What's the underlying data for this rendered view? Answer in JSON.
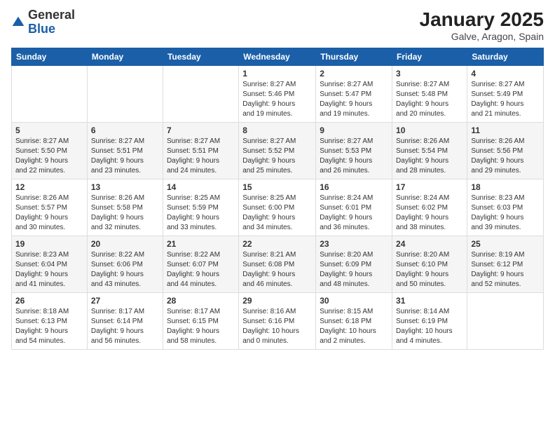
{
  "logo": {
    "general": "General",
    "blue": "Blue"
  },
  "title": "January 2025",
  "subtitle": "Galve, Aragon, Spain",
  "days_of_week": [
    "Sunday",
    "Monday",
    "Tuesday",
    "Wednesday",
    "Thursday",
    "Friday",
    "Saturday"
  ],
  "weeks": [
    [
      {
        "num": "",
        "info": ""
      },
      {
        "num": "",
        "info": ""
      },
      {
        "num": "",
        "info": ""
      },
      {
        "num": "1",
        "info": "Sunrise: 8:27 AM\nSunset: 5:46 PM\nDaylight: 9 hours\nand 19 minutes."
      },
      {
        "num": "2",
        "info": "Sunrise: 8:27 AM\nSunset: 5:47 PM\nDaylight: 9 hours\nand 19 minutes."
      },
      {
        "num": "3",
        "info": "Sunrise: 8:27 AM\nSunset: 5:48 PM\nDaylight: 9 hours\nand 20 minutes."
      },
      {
        "num": "4",
        "info": "Sunrise: 8:27 AM\nSunset: 5:49 PM\nDaylight: 9 hours\nand 21 minutes."
      }
    ],
    [
      {
        "num": "5",
        "info": "Sunrise: 8:27 AM\nSunset: 5:50 PM\nDaylight: 9 hours\nand 22 minutes."
      },
      {
        "num": "6",
        "info": "Sunrise: 8:27 AM\nSunset: 5:51 PM\nDaylight: 9 hours\nand 23 minutes."
      },
      {
        "num": "7",
        "info": "Sunrise: 8:27 AM\nSunset: 5:51 PM\nDaylight: 9 hours\nand 24 minutes."
      },
      {
        "num": "8",
        "info": "Sunrise: 8:27 AM\nSunset: 5:52 PM\nDaylight: 9 hours\nand 25 minutes."
      },
      {
        "num": "9",
        "info": "Sunrise: 8:27 AM\nSunset: 5:53 PM\nDaylight: 9 hours\nand 26 minutes."
      },
      {
        "num": "10",
        "info": "Sunrise: 8:26 AM\nSunset: 5:54 PM\nDaylight: 9 hours\nand 28 minutes."
      },
      {
        "num": "11",
        "info": "Sunrise: 8:26 AM\nSunset: 5:56 PM\nDaylight: 9 hours\nand 29 minutes."
      }
    ],
    [
      {
        "num": "12",
        "info": "Sunrise: 8:26 AM\nSunset: 5:57 PM\nDaylight: 9 hours\nand 30 minutes."
      },
      {
        "num": "13",
        "info": "Sunrise: 8:26 AM\nSunset: 5:58 PM\nDaylight: 9 hours\nand 32 minutes."
      },
      {
        "num": "14",
        "info": "Sunrise: 8:25 AM\nSunset: 5:59 PM\nDaylight: 9 hours\nand 33 minutes."
      },
      {
        "num": "15",
        "info": "Sunrise: 8:25 AM\nSunset: 6:00 PM\nDaylight: 9 hours\nand 34 minutes."
      },
      {
        "num": "16",
        "info": "Sunrise: 8:24 AM\nSunset: 6:01 PM\nDaylight: 9 hours\nand 36 minutes."
      },
      {
        "num": "17",
        "info": "Sunrise: 8:24 AM\nSunset: 6:02 PM\nDaylight: 9 hours\nand 38 minutes."
      },
      {
        "num": "18",
        "info": "Sunrise: 8:23 AM\nSunset: 6:03 PM\nDaylight: 9 hours\nand 39 minutes."
      }
    ],
    [
      {
        "num": "19",
        "info": "Sunrise: 8:23 AM\nSunset: 6:04 PM\nDaylight: 9 hours\nand 41 minutes."
      },
      {
        "num": "20",
        "info": "Sunrise: 8:22 AM\nSunset: 6:06 PM\nDaylight: 9 hours\nand 43 minutes."
      },
      {
        "num": "21",
        "info": "Sunrise: 8:22 AM\nSunset: 6:07 PM\nDaylight: 9 hours\nand 44 minutes."
      },
      {
        "num": "22",
        "info": "Sunrise: 8:21 AM\nSunset: 6:08 PM\nDaylight: 9 hours\nand 46 minutes."
      },
      {
        "num": "23",
        "info": "Sunrise: 8:20 AM\nSunset: 6:09 PM\nDaylight: 9 hours\nand 48 minutes."
      },
      {
        "num": "24",
        "info": "Sunrise: 8:20 AM\nSunset: 6:10 PM\nDaylight: 9 hours\nand 50 minutes."
      },
      {
        "num": "25",
        "info": "Sunrise: 8:19 AM\nSunset: 6:12 PM\nDaylight: 9 hours\nand 52 minutes."
      }
    ],
    [
      {
        "num": "26",
        "info": "Sunrise: 8:18 AM\nSunset: 6:13 PM\nDaylight: 9 hours\nand 54 minutes."
      },
      {
        "num": "27",
        "info": "Sunrise: 8:17 AM\nSunset: 6:14 PM\nDaylight: 9 hours\nand 56 minutes."
      },
      {
        "num": "28",
        "info": "Sunrise: 8:17 AM\nSunset: 6:15 PM\nDaylight: 9 hours\nand 58 minutes."
      },
      {
        "num": "29",
        "info": "Sunrise: 8:16 AM\nSunset: 6:16 PM\nDaylight: 10 hours\nand 0 minutes."
      },
      {
        "num": "30",
        "info": "Sunrise: 8:15 AM\nSunset: 6:18 PM\nDaylight: 10 hours\nand 2 minutes."
      },
      {
        "num": "31",
        "info": "Sunrise: 8:14 AM\nSunset: 6:19 PM\nDaylight: 10 hours\nand 4 minutes."
      },
      {
        "num": "",
        "info": ""
      }
    ]
  ]
}
